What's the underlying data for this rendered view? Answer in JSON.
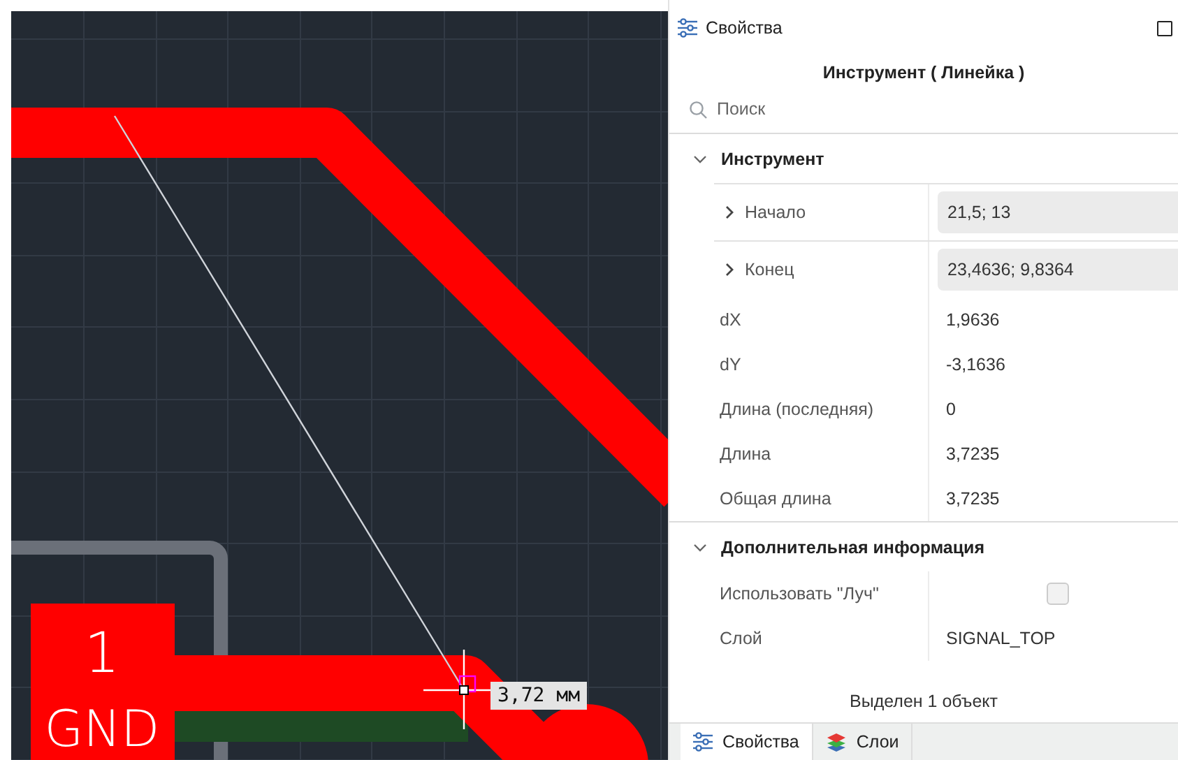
{
  "canvas": {
    "pad": {
      "number": "1",
      "net": "GND"
    },
    "measurement": "3,72 мм"
  },
  "panel": {
    "title": "Свойства",
    "heading": "Инструмент ( Линейка )",
    "search": {
      "placeholder": "Поиск"
    },
    "sections": [
      {
        "title": "Инструмент",
        "expanded": true,
        "rows": [
          {
            "kind": "expandable",
            "label": "Начало",
            "value": "21,5; 13",
            "expanded": false
          },
          {
            "kind": "expandable",
            "label": "Конец",
            "value": "23,4636; 9,8364",
            "expanded": false
          },
          {
            "kind": "plain",
            "label": "dX",
            "value": "1,9636"
          },
          {
            "kind": "plain",
            "label": "dY",
            "value": "-3,1636"
          },
          {
            "kind": "plain",
            "label": "Длина (последняя)",
            "value": "0"
          },
          {
            "kind": "plain",
            "label": "Длина",
            "value": "3,7235"
          },
          {
            "kind": "plain",
            "label": "Общая длина",
            "value": "3,7235"
          }
        ]
      },
      {
        "title": "Дополнительная информация",
        "expanded": true,
        "rows": [
          {
            "kind": "checkbox",
            "label": "Использовать \"Луч\"",
            "checked": false
          },
          {
            "kind": "plain",
            "label": "Слой",
            "value": "SIGNAL_TOP"
          }
        ]
      }
    ],
    "status": "Выделен 1 объект",
    "tabs": [
      {
        "label": "Свойства",
        "selected": true,
        "kind": "sliders"
      },
      {
        "label": "Слои",
        "selected": false,
        "kind": "layers"
      }
    ]
  }
}
